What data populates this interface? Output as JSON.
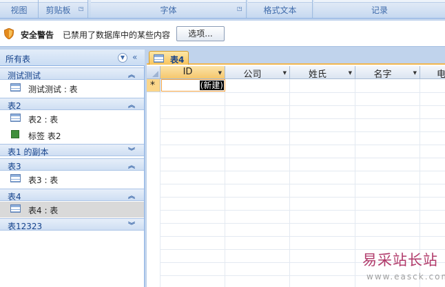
{
  "ribbon": {
    "groups": [
      {
        "label": "视图"
      },
      {
        "label": "剪贴板"
      },
      {
        "label": "字体"
      },
      {
        "label": "格式文本"
      },
      {
        "label": "记录"
      }
    ]
  },
  "security": {
    "title": "安全警告",
    "message": "已禁用了数据库中的某些内容",
    "options_label": "选项..."
  },
  "nav": {
    "header": "所有表",
    "groups": [
      {
        "title": "测试测试",
        "expanded": true,
        "items": [
          {
            "label": "测试测试 : 表",
            "icon": "table-icon"
          }
        ]
      },
      {
        "title": "表2",
        "expanded": true,
        "items": [
          {
            "label": "表2 : 表",
            "icon": "table-icon"
          },
          {
            "label": "标签 表2",
            "icon": "report-icon"
          }
        ]
      },
      {
        "title": "表1 的副本",
        "expanded": false,
        "items": []
      },
      {
        "title": "表3",
        "expanded": true,
        "items": [
          {
            "label": "表3 : 表",
            "icon": "table-icon"
          }
        ]
      },
      {
        "title": "表4",
        "expanded": true,
        "items": [
          {
            "label": "表4 : 表",
            "icon": "table-icon",
            "selected": true
          }
        ]
      },
      {
        "title": "表12323",
        "expanded": false,
        "items": []
      }
    ]
  },
  "document": {
    "tab_label": "表4",
    "columns": [
      "ID",
      "公司",
      "姓氏",
      "名字",
      "电"
    ],
    "new_record_label": "(新建)"
  },
  "watermark": {
    "text": "易采站长站",
    "url": "www.easck.com"
  },
  "colors": {
    "accent": "#f2b64d",
    "nav_text": "#15428b",
    "frame": "#c0d3ec"
  }
}
